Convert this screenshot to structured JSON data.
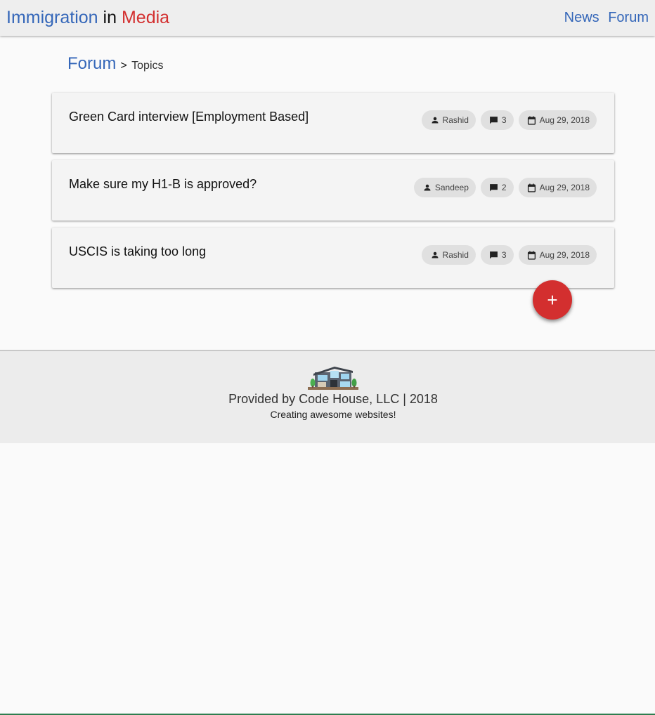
{
  "header": {
    "brand": {
      "part1": "Immigration",
      "part2": "in",
      "part3": "Media"
    },
    "nav": [
      {
        "label": "News"
      },
      {
        "label": "Forum"
      }
    ]
  },
  "breadcrumb": {
    "root": "Forum",
    "separator": ">",
    "current": "Topics"
  },
  "topics": [
    {
      "title": "Green Card interview [Employment Based]",
      "author": "Rashid",
      "comments": "3",
      "date": "Aug 29, 2018"
    },
    {
      "title": "Make sure my H1-B is approved?",
      "author": "Sandeep",
      "comments": "2",
      "date": "Aug 29, 2018"
    },
    {
      "title": "USCIS is taking too long",
      "author": "Rashid",
      "comments": "3",
      "date": "Aug 29, 2018"
    }
  ],
  "fab": {
    "label": "+"
  },
  "footer": {
    "line1": "Provided by Code House, LLC | 2018",
    "line2": "Creating awesome websites!"
  },
  "icons": {
    "author": "person-icon",
    "comments": "comment-icon",
    "date": "calendar-icon",
    "logo": "house-logo"
  },
  "colors": {
    "brand_blue": "#3567b9",
    "brand_red": "#d32f2f",
    "header_bg": "#eeeeee",
    "footer_bg": "#ececec"
  }
}
